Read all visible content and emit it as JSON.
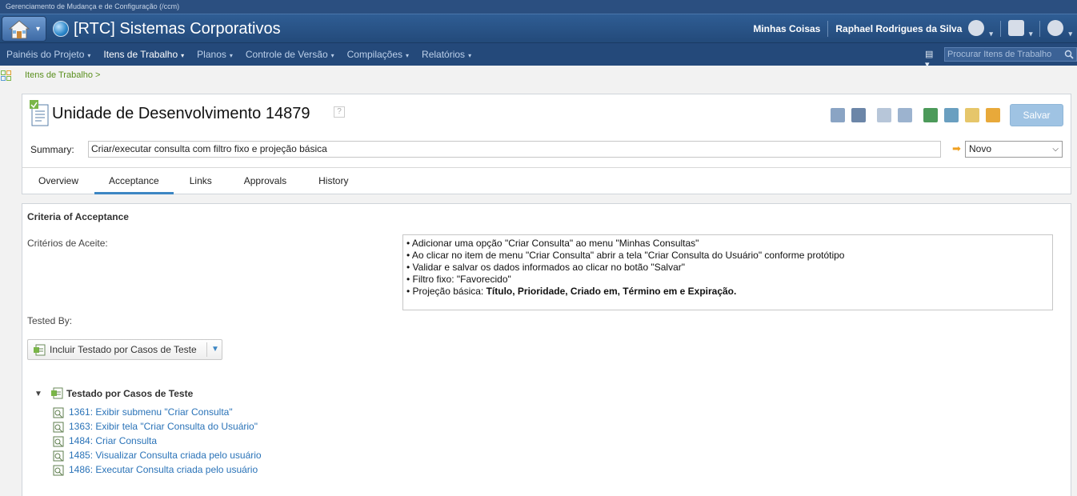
{
  "topbar": {
    "app_context": "Gerenciamento de Mudança e de Configuração (/ccm)"
  },
  "header": {
    "project_title": "[RTC] Sistemas Corporativos",
    "my_stuff": "Minhas Coisas",
    "user_name": "Raphael Rodrigues da Silva"
  },
  "nav": {
    "items": [
      {
        "label": "Painéis do Projeto"
      },
      {
        "label": "Itens de Trabalho"
      },
      {
        "label": "Planos"
      },
      {
        "label": "Controle de Versão"
      },
      {
        "label": "Compilações"
      },
      {
        "label": "Relatórios"
      }
    ],
    "search_placeholder": "Procurar Itens de Trabalho"
  },
  "breadcrumb": "Itens de Trabalho >",
  "work_item": {
    "title": "Unidade de Desenvolvimento 14879",
    "save_label": "Salvar",
    "summary_label": "Summary:",
    "summary_value": "Criar/executar consulta com filtro fixo e projeção básica",
    "state": "Novo",
    "tabs": [
      {
        "label": "Overview"
      },
      {
        "label": "Acceptance"
      },
      {
        "label": "Links"
      },
      {
        "label": "Approvals"
      },
      {
        "label": "History"
      }
    ],
    "active_tab": "Acceptance"
  },
  "acceptance": {
    "section_title": "Criteria of Acceptance",
    "criteria_label": "Critérios de Aceite:",
    "criteria": [
      "• Adicionar uma opção \"Criar Consulta\" ao menu \"Minhas Consultas\"",
      "• Ao clicar no item de menu \"Criar Consulta\" abrir a tela \"Criar Consulta do Usuário\" conforme protótipo",
      "• Validar e salvar os dados informados ao clicar no botão \"Salvar\"",
      "• Filtro fixo: \"Favorecido\""
    ],
    "criteria_last_prefix": "• Projeção básica: ",
    "criteria_last_bold": "Título, Prioridade, Criado em, Término em e Expiração.",
    "tested_by_label": "Tested By:",
    "include_button": "Incluir Testado por Casos de Teste",
    "tree_title": "Testado por Casos de Teste",
    "test_cases": [
      "1361: Exibir submenu \"Criar Consulta\"",
      "1363: Exibir tela \"Criar Consulta do Usuário\"",
      "1484: Criar Consulta",
      "1485: Visualizar Consulta criada pelo usuário",
      "1486: Executar Consulta criada pelo usuário"
    ]
  }
}
